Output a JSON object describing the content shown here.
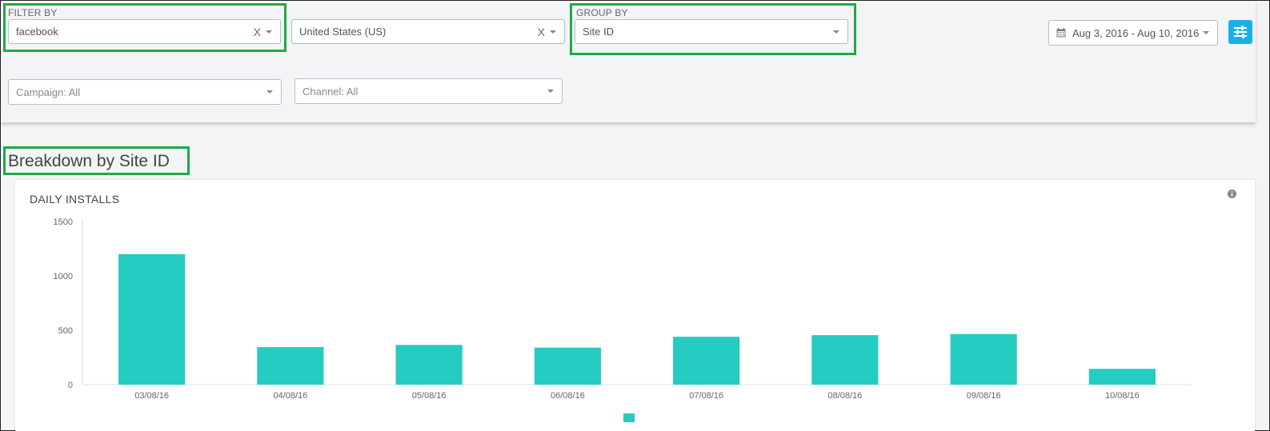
{
  "filters": {
    "filter_by_label": "FILTER BY",
    "media_source": {
      "value": "facebook",
      "clear": "X"
    },
    "country": {
      "value": "United States (US)",
      "clear": "X"
    },
    "campaign": {
      "placeholder": "Campaign: All"
    },
    "channel": {
      "placeholder": "Channel: All"
    }
  },
  "group_by": {
    "label": "GROUP BY",
    "value": "Site ID"
  },
  "date_range": {
    "value": "Aug 3, 2016 - Aug 10, 2016"
  },
  "breakdown_title": "Breakdown by Site ID",
  "colors": {
    "bar": "#26cbc1",
    "highlight": "#1faa47",
    "accent": "#1ab1e6"
  },
  "chart_data": {
    "type": "bar",
    "title": "DAILY INSTALLS",
    "categories": [
      "03/08/16",
      "04/08/16",
      "05/08/16",
      "06/08/16",
      "07/08/16",
      "08/08/16",
      "09/08/16",
      "10/08/16"
    ],
    "values": [
      1200,
      345,
      365,
      340,
      440,
      455,
      465,
      145
    ],
    "ylim": [
      0,
      1500
    ],
    "yticks": [
      0,
      500,
      1000,
      1500
    ],
    "grid": false,
    "legend": "bottom-center"
  }
}
